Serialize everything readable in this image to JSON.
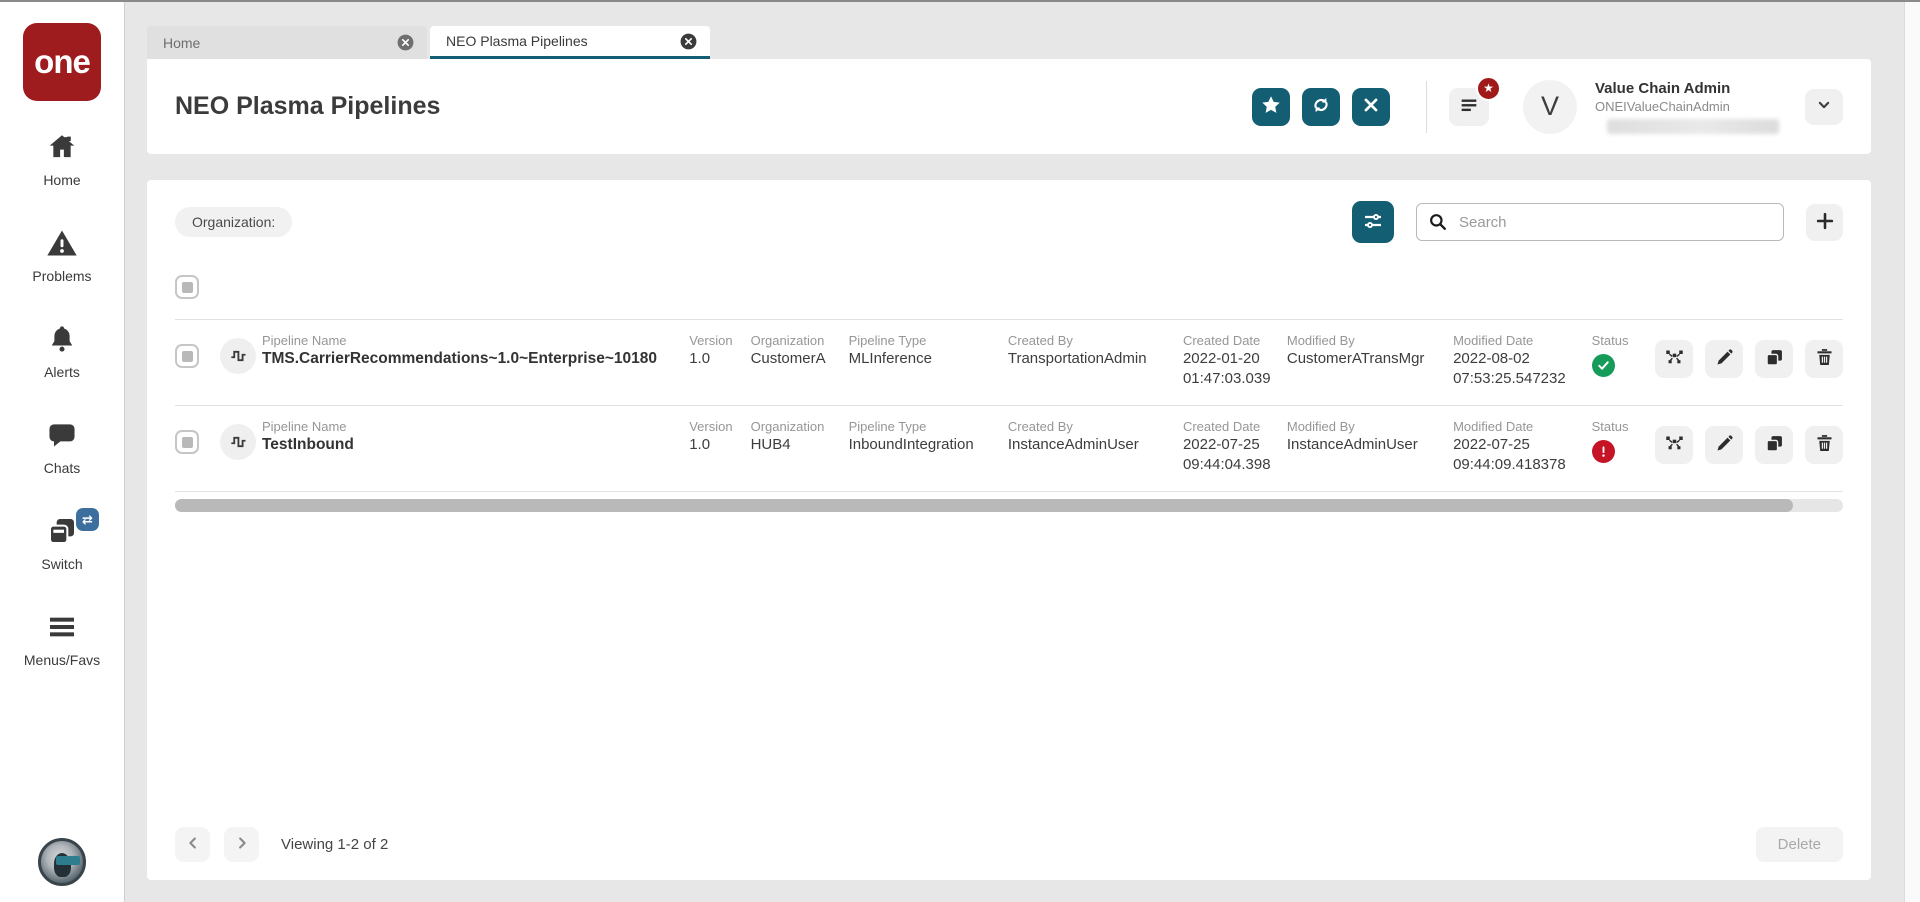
{
  "app": {
    "logo_text": "one"
  },
  "colors": {
    "accent_teal": "#135e73",
    "brand_red": "#9e1b1e",
    "status_green": "#169b58",
    "status_red": "#c41425",
    "switch_badge_blue": "#3d6f9e"
  },
  "sidebar": {
    "items": [
      {
        "label": "Home",
        "icon": "home-icon"
      },
      {
        "label": "Problems",
        "icon": "warning-icon"
      },
      {
        "label": "Alerts",
        "icon": "bell-icon"
      },
      {
        "label": "Chats",
        "icon": "chat-icon"
      },
      {
        "label": "Switch",
        "icon": "switch-icon",
        "badge": "⇄"
      },
      {
        "label": "Menus/Favs",
        "icon": "menu-bars-icon"
      }
    ]
  },
  "tabs": [
    {
      "label": "Home",
      "active": false
    },
    {
      "label": "NEO Plasma Pipelines",
      "active": true
    }
  ],
  "header": {
    "title": "NEO Plasma Pipelines",
    "user": {
      "name": "Value Chain Admin",
      "id": "ONEIValueChainAdmin",
      "avatar_initial": "V"
    }
  },
  "filters": {
    "organization_label": "Organization:",
    "search_placeholder": "Search"
  },
  "table": {
    "labels": {
      "pipeline_name": "Pipeline Name",
      "version": "Version",
      "organization": "Organization",
      "pipeline_type": "Pipeline Type",
      "created_by": "Created By",
      "created_date": "Created Date",
      "modified_by": "Modified By",
      "modified_date": "Modified Date",
      "status": "Status"
    },
    "rows": [
      {
        "pipeline_name": "TMS.CarrierRecommendations~1.0~Enterprise~10180",
        "version": "1.0",
        "organization": "CustomerA",
        "pipeline_type": "MLInference",
        "created_by": "TransportationAdmin",
        "created_date": "2022-01-20",
        "created_time": "01:47:03.039",
        "modified_by": "CustomerATransMgr",
        "modified_date": "2022-08-02",
        "modified_time": "07:53:25.547232",
        "status": "success"
      },
      {
        "pipeline_name": "TestInbound",
        "version": "1.0",
        "organization": "HUB4",
        "pipeline_type": "InboundIntegration",
        "created_by": "InstanceAdminUser",
        "created_date": "2022-07-25",
        "created_time": "09:44:04.398",
        "modified_by": "InstanceAdminUser",
        "modified_date": "2022-07-25",
        "modified_time": "09:44:09.418378",
        "status": "error"
      }
    ]
  },
  "footer": {
    "viewing_text": "Viewing 1-2 of 2",
    "delete_label": "Delete"
  }
}
